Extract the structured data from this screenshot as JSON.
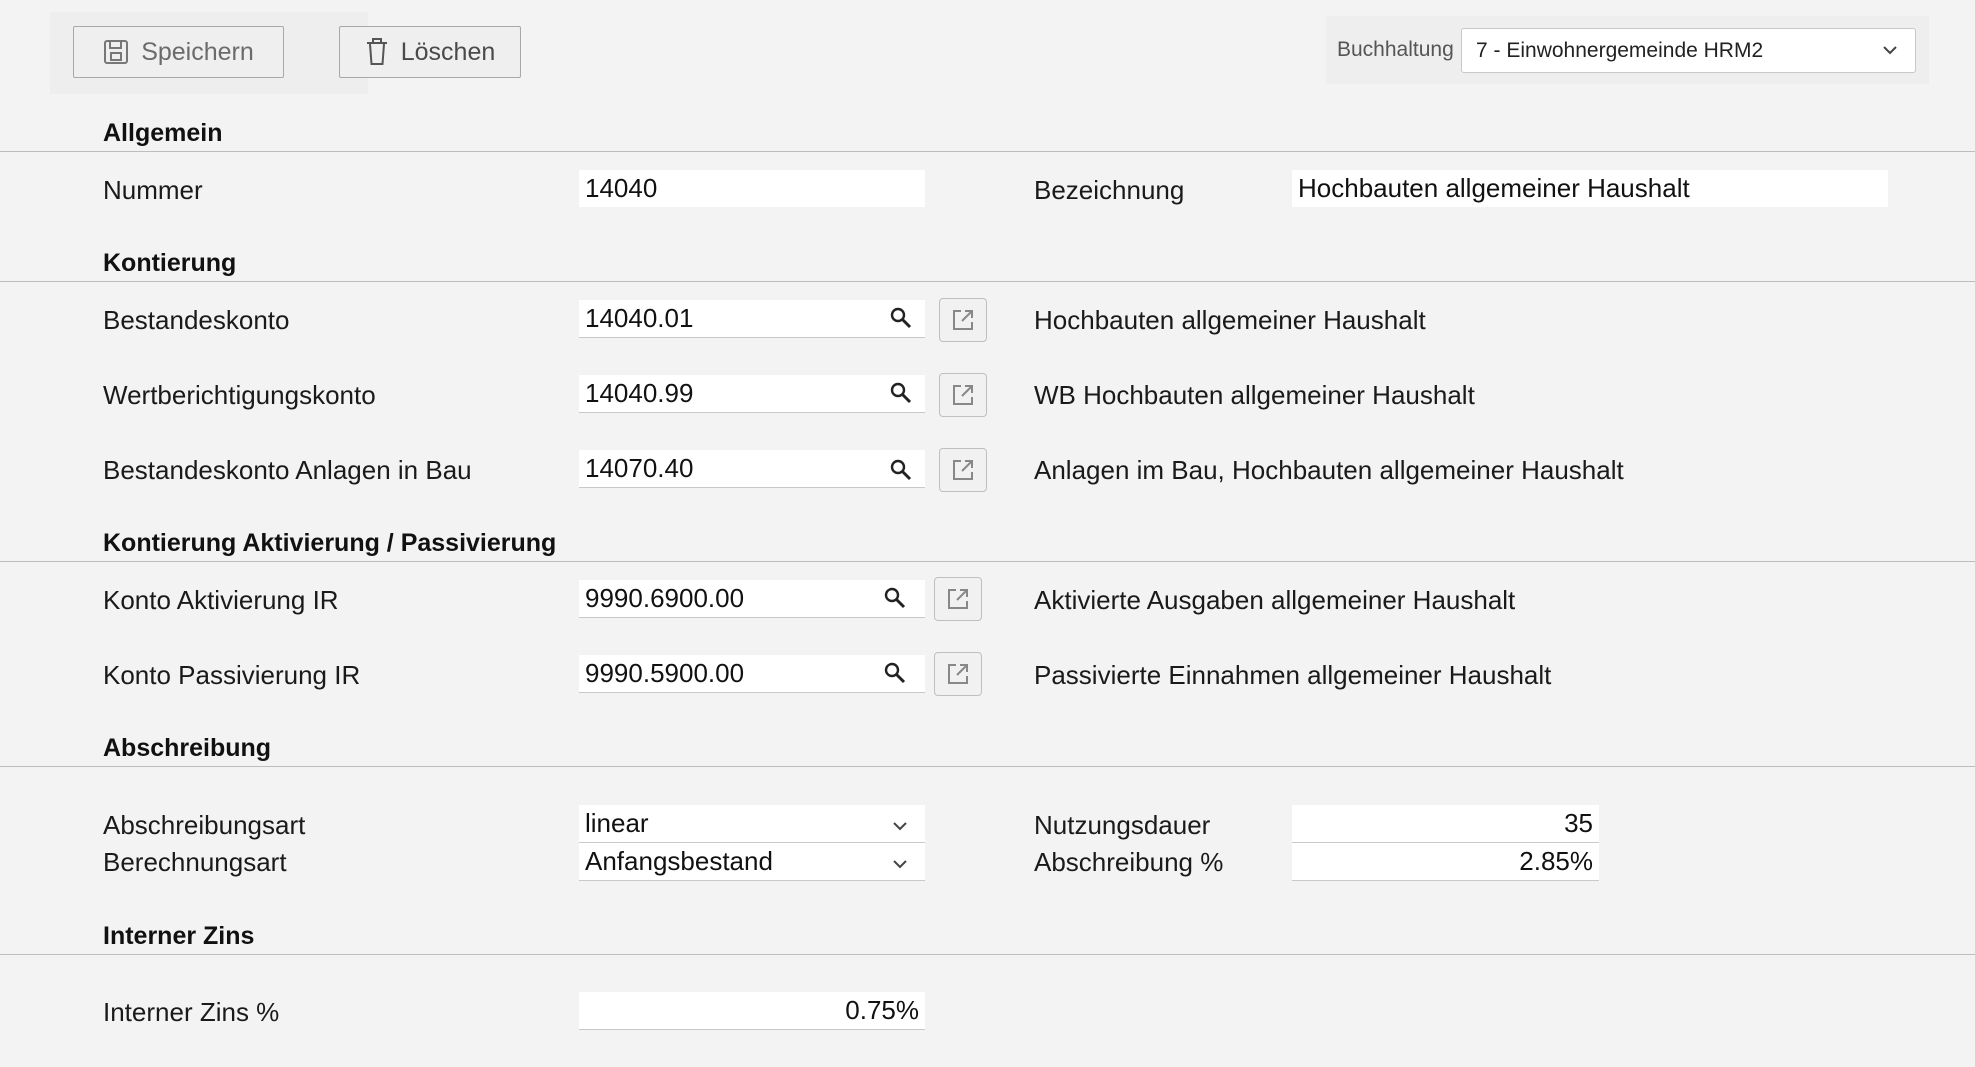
{
  "toolbar": {
    "save_label": "Speichern",
    "delete_label": "Löschen"
  },
  "accounting": {
    "label": "Buchhaltung",
    "value": "7 - Einwohnergemeinde HRM2"
  },
  "sections": {
    "general": "Allgemein",
    "posting": "Kontierung",
    "posting_capitalization": "Kontierung Aktivierung / Passivierung",
    "depreciation": "Abschreibung",
    "internal_interest": "Interner Zins"
  },
  "general": {
    "number_label": "Nummer",
    "number_value": "14040",
    "designation_label": "Bezeichnung",
    "designation_value": "Hochbauten allgemeiner Haushalt"
  },
  "posting": {
    "rows": [
      {
        "label": "Bestandeskonto",
        "value": "14040.01",
        "description": "Hochbauten allgemeiner Haushalt"
      },
      {
        "label": "Wertberichtigungskonto",
        "value": "14040.99",
        "description": "WB Hochbauten allgemeiner Haushalt"
      },
      {
        "label": "Bestandeskonto Anlagen in Bau",
        "value": "14070.40",
        "description": "Anlagen im Bau, Hochbauten allgemeiner Haushalt"
      }
    ]
  },
  "capitalization": {
    "rows": [
      {
        "label": "Konto Aktivierung IR",
        "value": "9990.6900.00",
        "description": "Aktivierte Ausgaben allgemeiner Haushalt"
      },
      {
        "label": "Konto Passivierung IR",
        "value": "9990.5900.00",
        "description": "Passivierte Einnahmen allgemeiner Haushalt"
      }
    ]
  },
  "depreciation": {
    "type_label": "Abschreibungsart",
    "type_value": "linear",
    "calc_label": "Berechnungsart",
    "calc_value": "Anfangsbestand",
    "useful_life_label": "Nutzungsdauer",
    "useful_life_value": "35",
    "rate_label": "Abschreibung %",
    "rate_value": "2.85%"
  },
  "interest": {
    "label": "Interner Zins %",
    "value": "0.75%"
  },
  "colors": {
    "background": "#f3f3f3",
    "input_background": "#ffffff",
    "divider": "#bdbdbd"
  }
}
